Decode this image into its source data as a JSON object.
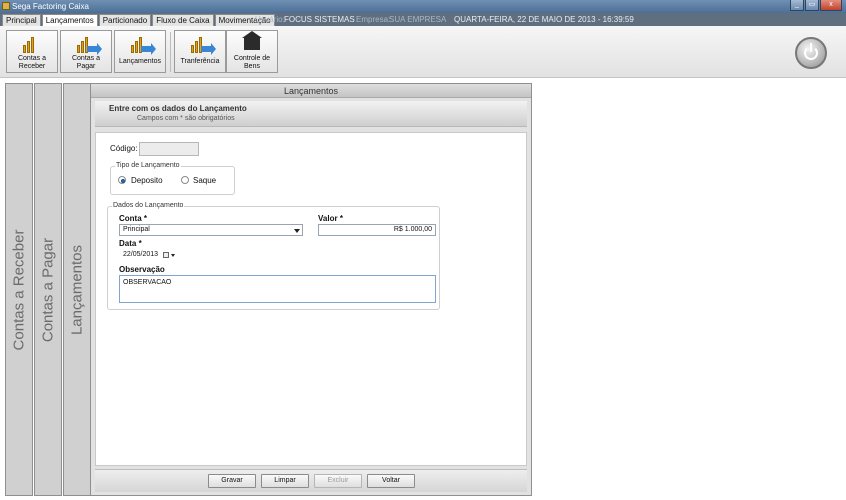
{
  "window": {
    "title": "Sega Factoring Caixa",
    "controls": [
      "_",
      "▭",
      "x"
    ]
  },
  "tabs": [
    {
      "label": "Principal",
      "active": false
    },
    {
      "label": "Lançamentos",
      "active": true
    },
    {
      "label": "Particionado",
      "active": false
    },
    {
      "label": "Fluxo de Caixa",
      "active": false
    },
    {
      "label": "Movimentação",
      "active": false
    }
  ],
  "infobar": {
    "user_label": "Usuário:",
    "user_value": "FOCUS SISTEMAS",
    "company_label": "Empresa:",
    "company_value": "SUA EMPRESA",
    "datetime": "QUARTA-FEIRA, 22 DE MAIO DE 2013 - 16:39:59"
  },
  "toolbar": {
    "contas_receber": {
      "line1": "Contas a",
      "line2": "Receber",
      "icon": "bar-chart-icon"
    },
    "contas_pagar": {
      "line1": "Contas a",
      "line2": "Pagar",
      "icon": "bar-chart-arrow-icon"
    },
    "lancamentos": {
      "line1": "Lançamentos",
      "icon": "transfer-icon"
    },
    "tranferencia": {
      "line1": "Tranferência",
      "icon": "transfer-chart-icon"
    },
    "controle_bens": {
      "line1": "Controle de",
      "line2": "Bens",
      "icon": "house-icon"
    },
    "power_icon": "power-icon"
  },
  "side_panels": {
    "contas_receber": "Contas a Receber",
    "contas_pagar": "Contas a Pagar",
    "lancamentos": "Lançamentos"
  },
  "main": {
    "header": "Lançamentos",
    "form_title": "Entre com os dados do Lançamento",
    "form_subtitle": "Campos com * são obrigatórios",
    "codigo_label": "Código:",
    "codigo_value": "",
    "tipo": {
      "legend": "Tipo de Lançamento",
      "options": [
        {
          "label": "Deposito",
          "selected": true
        },
        {
          "label": "Saque",
          "selected": false
        }
      ]
    },
    "dados": {
      "legend": "Dados do Lançamento",
      "conta_label": "Conta",
      "conta_value": "Principal",
      "valor_label": "Valor",
      "valor_value": "R$ 1.000,00",
      "data_label": "Data",
      "data_value": "22/05/2013",
      "obs_label": "Observação",
      "obs_value": "OBSERVACAO",
      "required_mark": "*"
    },
    "buttons": {
      "gravar": "Gravar",
      "limpar": "Limpar",
      "excluir": "Excluir",
      "voltar": "Voltar"
    }
  },
  "colors": {
    "titlebar": "#4d6f96",
    "tabrow": "#5f6f7f",
    "panel_gray": "#d0d0d0",
    "accent_blue": "#2a6fc8"
  }
}
